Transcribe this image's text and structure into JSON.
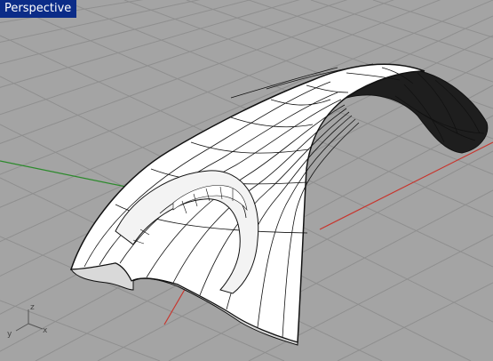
{
  "viewport": {
    "title": "Perspective",
    "title_bg": "#0b2c88",
    "background": "#a4a4a4",
    "grid_color": "#8f8f8f",
    "x_axis_color": "#c8352d",
    "y_axis_color": "#2c8a2c"
  },
  "axis_icon": {
    "x_label": "x",
    "y_label": "y",
    "z_label": "z"
  },
  "model": {
    "surface_color": "#ffffff",
    "wire_color": "#111111",
    "shade_color": "#1e1e1e"
  }
}
